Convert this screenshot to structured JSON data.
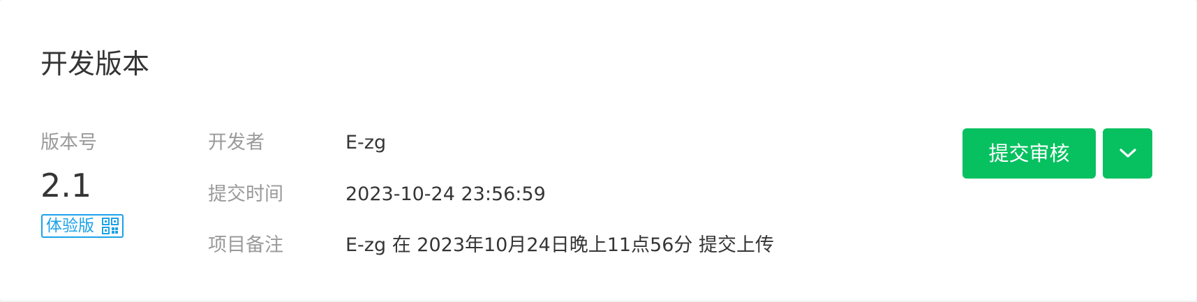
{
  "section": {
    "title": "开发版本"
  },
  "version": {
    "label": "版本号",
    "number": "2.1",
    "badge_label": "体验版",
    "badge_icon": "qrcode-icon"
  },
  "details": [
    {
      "label": "开发者",
      "value": "E-zg"
    },
    {
      "label": "提交时间",
      "value": "2023-10-24 23:56:59"
    },
    {
      "label": "项目备注",
      "value": "E-zg 在 2023年10月24日晚上11点56分 提交上传"
    }
  ],
  "actions": {
    "submit_label": "提交审核",
    "more_icon": "chevron-down-icon"
  },
  "colors": {
    "accent_green": "#07c160",
    "badge_blue": "#1aa2e8",
    "text_primary": "#353535",
    "text_secondary": "#9a9a9a"
  }
}
